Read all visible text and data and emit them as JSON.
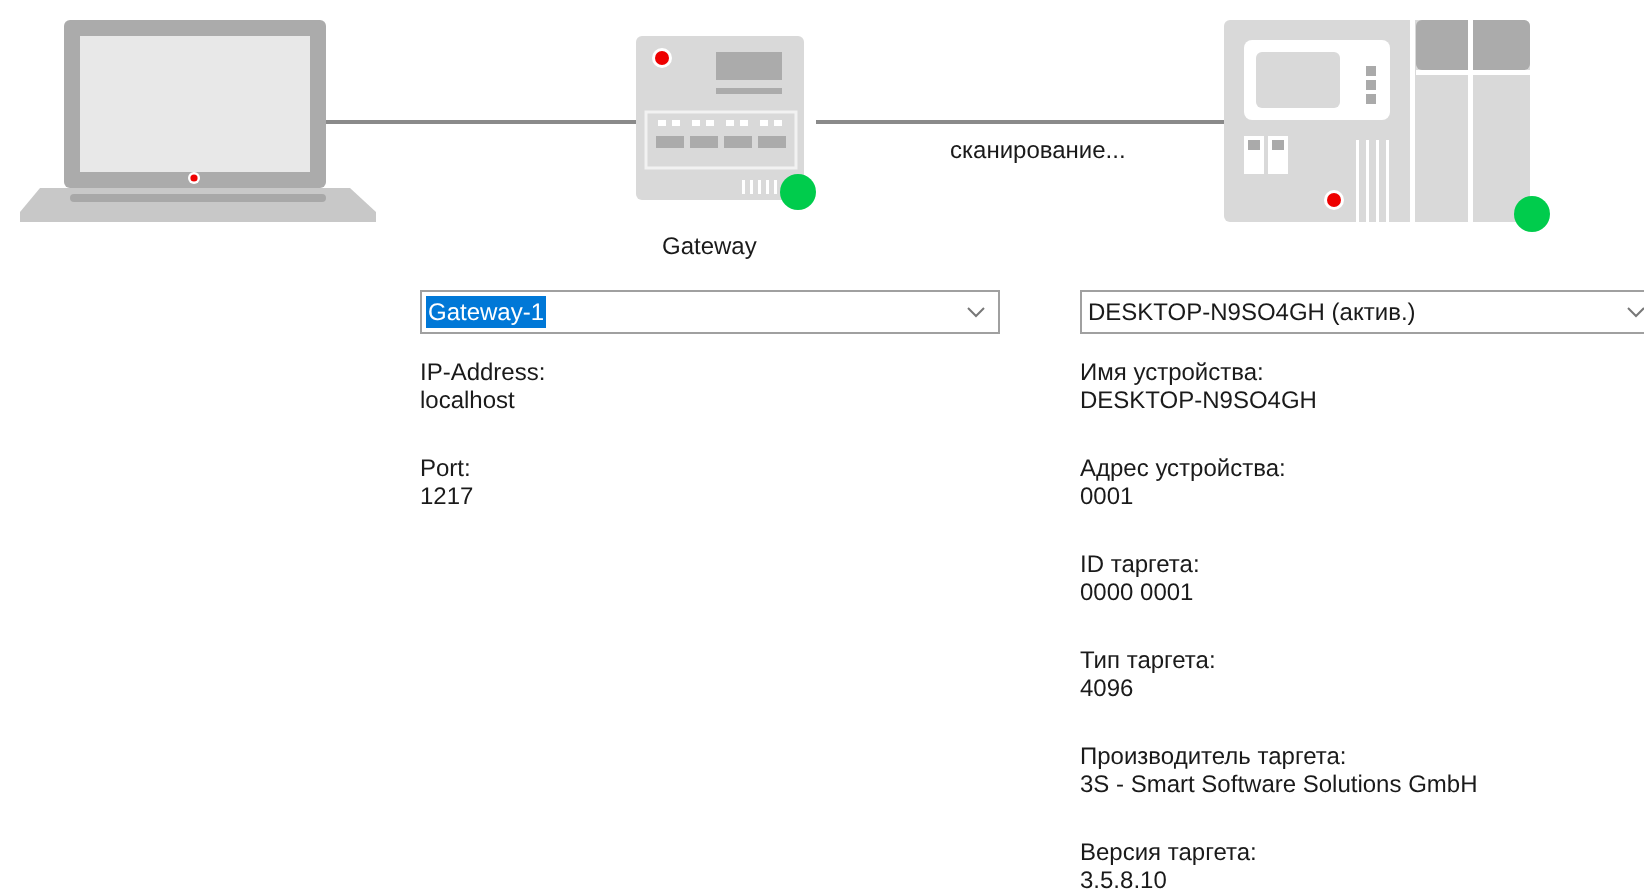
{
  "diagram": {
    "gateway": {
      "label": "Gateway",
      "online": true
    },
    "status_text": "сканирование...",
    "device": {
      "online": true
    }
  },
  "gateway_panel": {
    "combo": {
      "value": "Gateway-1",
      "focused": true
    },
    "fields": [
      {
        "label": "IP-Address:",
        "value": "localhost"
      },
      {
        "label": "Port:",
        "value": "1217"
      }
    ]
  },
  "device_panel": {
    "combo": {
      "value": "DESKTOP-N9SO4GH (актив.)",
      "focused": false
    },
    "fields": [
      {
        "label": "Имя устройства:",
        "value": "DESKTOP-N9SO4GH"
      },
      {
        "label": "Адрес устройства:",
        "value": "0001"
      },
      {
        "label": "ID таргета:",
        "value": "0000 0001"
      },
      {
        "label": "Тип таргета:",
        "value": "4096"
      },
      {
        "label": "Производитель таргета:",
        "value": "3S - Smart Software Solutions GmbH"
      },
      {
        "label": "Версия таргета:",
        "value": "3.5.8.10"
      }
    ]
  }
}
